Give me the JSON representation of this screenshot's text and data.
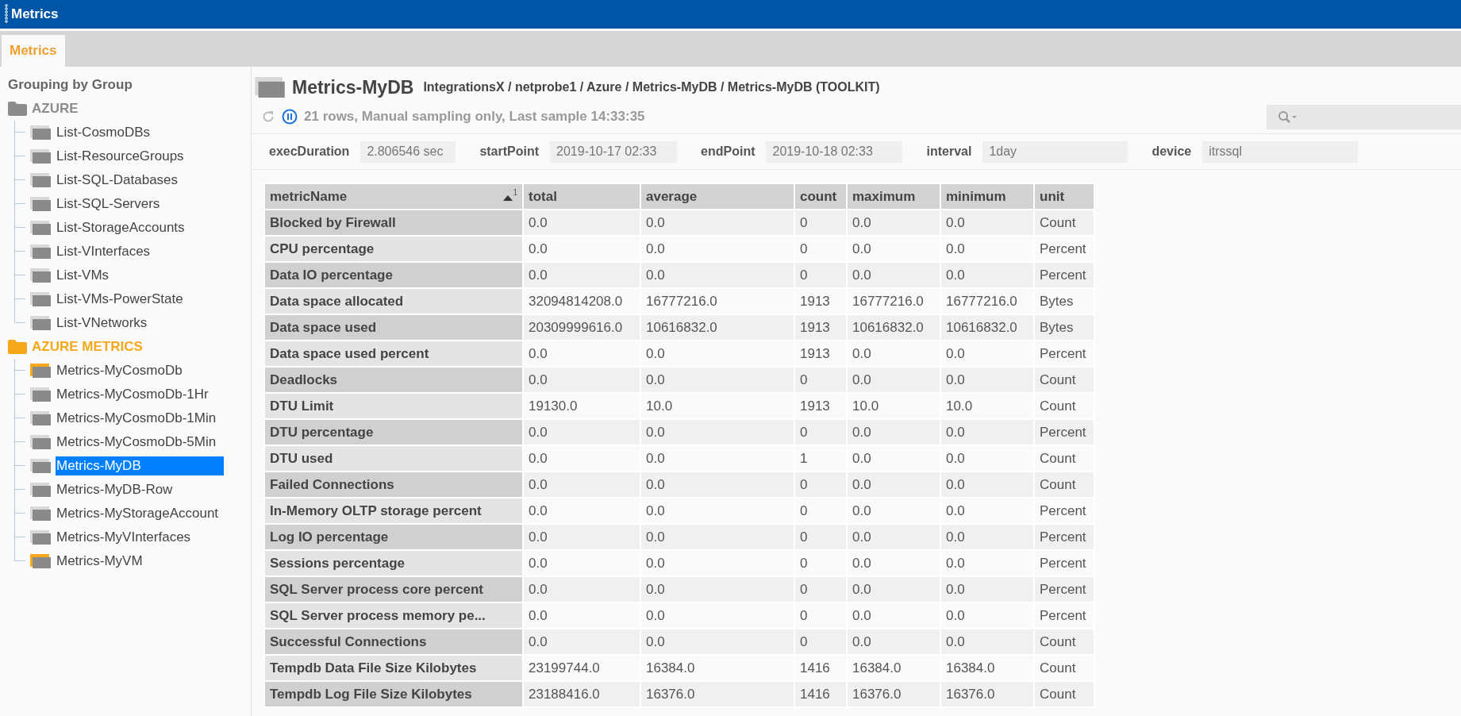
{
  "window": {
    "title": "Metrics"
  },
  "tabs": [
    {
      "label": "Metrics",
      "selected": true
    }
  ],
  "sidebar": {
    "title": "Grouping by Group",
    "groups": [
      {
        "label": "AZURE",
        "color": "#8c8c8c",
        "children": [
          {
            "label": "List-CosmoDBs",
            "selected": false,
            "highlighted": false
          },
          {
            "label": "List-ResourceGroups",
            "selected": false,
            "highlighted": false
          },
          {
            "label": "List-SQL-Databases",
            "selected": false,
            "highlighted": false
          },
          {
            "label": "List-SQL-Servers",
            "selected": false,
            "highlighted": false
          },
          {
            "label": "List-StorageAccounts",
            "selected": false,
            "highlighted": false
          },
          {
            "label": "List-VInterfaces",
            "selected": false,
            "highlighted": false
          },
          {
            "label": "List-VMs",
            "selected": false,
            "highlighted": false
          },
          {
            "label": "List-VMs-PowerState",
            "selected": false,
            "highlighted": false
          },
          {
            "label": "List-VNetworks",
            "selected": false,
            "highlighted": false
          }
        ]
      },
      {
        "label": "AZURE METRICS",
        "color": "#f5a81c",
        "children": [
          {
            "label": "Metrics-MyCosmoDb",
            "selected": false,
            "highlighted": true
          },
          {
            "label": "Metrics-MyCosmoDb-1Hr",
            "selected": false,
            "highlighted": false
          },
          {
            "label": "Metrics-MyCosmoDb-1Min",
            "selected": false,
            "highlighted": false
          },
          {
            "label": "Metrics-MyCosmoDb-5Min",
            "selected": false,
            "highlighted": false
          },
          {
            "label": "Metrics-MyDB",
            "selected": true,
            "highlighted": false
          },
          {
            "label": "Metrics-MyDB-Row",
            "selected": false,
            "highlighted": false
          },
          {
            "label": "Metrics-MyStorageAccount",
            "selected": false,
            "highlighted": false
          },
          {
            "label": "Metrics-MyVInterfaces",
            "selected": false,
            "highlighted": false
          },
          {
            "label": "Metrics-MyVM",
            "selected": false,
            "highlighted": true
          }
        ]
      }
    ]
  },
  "header": {
    "title": "Metrics-MyDB",
    "path": "IntegrationsX / netprobe1 / Azure / Metrics-MyDB / Metrics-MyDB (TOOLKIT)",
    "status": "21 rows, Manual sampling only, Last sample 14:33:35",
    "paused": true
  },
  "params": [
    {
      "label": "execDuration",
      "value": "2.806546 sec"
    },
    {
      "label": "startPoint",
      "value": "2019-10-17 02:33"
    },
    {
      "label": "endPoint",
      "value": "2019-10-18 02:33"
    },
    {
      "label": "interval",
      "value": "1day"
    },
    {
      "label": "device",
      "value": "itrssql"
    }
  ],
  "table": {
    "columns": [
      {
        "label": "metricName",
        "sorted": true,
        "sort_rank": "1"
      },
      {
        "label": "total",
        "sorted": false
      },
      {
        "label": "average",
        "sorted": false
      },
      {
        "label": "count",
        "sorted": false
      },
      {
        "label": "maximum",
        "sorted": false
      },
      {
        "label": "minimum",
        "sorted": false
      },
      {
        "label": "unit",
        "sorted": false
      }
    ],
    "rows": [
      [
        "Blocked by Firewall",
        "0.0",
        "0.0",
        "0",
        "0.0",
        "0.0",
        "Count"
      ],
      [
        "CPU percentage",
        "0.0",
        "0.0",
        "0",
        "0.0",
        "0.0",
        "Percent"
      ],
      [
        "Data IO percentage",
        "0.0",
        "0.0",
        "0",
        "0.0",
        "0.0",
        "Percent"
      ],
      [
        "Data space allocated",
        "32094814208.0",
        "16777216.0",
        "1913",
        "16777216.0",
        "16777216.0",
        "Bytes"
      ],
      [
        "Data space used",
        "20309999616.0",
        "10616832.0",
        "1913",
        "10616832.0",
        "10616832.0",
        "Bytes"
      ],
      [
        "Data space used percent",
        "0.0",
        "0.0",
        "1913",
        "0.0",
        "0.0",
        "Percent"
      ],
      [
        "Deadlocks",
        "0.0",
        "0.0",
        "0",
        "0.0",
        "0.0",
        "Count"
      ],
      [
        "DTU Limit",
        "19130.0",
        "10.0",
        "1913",
        "10.0",
        "10.0",
        "Count"
      ],
      [
        "DTU percentage",
        "0.0",
        "0.0",
        "0",
        "0.0",
        "0.0",
        "Percent"
      ],
      [
        "DTU used",
        "0.0",
        "0.0",
        "1",
        "0.0",
        "0.0",
        "Count"
      ],
      [
        "Failed Connections",
        "0.0",
        "0.0",
        "0",
        "0.0",
        "0.0",
        "Count"
      ],
      [
        "In-Memory OLTP storage percent",
        "0.0",
        "0.0",
        "0",
        "0.0",
        "0.0",
        "Percent"
      ],
      [
        "Log IO percentage",
        "0.0",
        "0.0",
        "0",
        "0.0",
        "0.0",
        "Percent"
      ],
      [
        "Sessions percentage",
        "0.0",
        "0.0",
        "0",
        "0.0",
        "0.0",
        "Percent"
      ],
      [
        "SQL Server process core percent",
        "0.0",
        "0.0",
        "0",
        "0.0",
        "0.0",
        "Percent"
      ],
      [
        "SQL Server process memory pe...",
        "0.0",
        "0.0",
        "0",
        "0.0",
        "0.0",
        "Percent"
      ],
      [
        "Successful Connections",
        "0.0",
        "0.0",
        "0",
        "0.0",
        "0.0",
        "Count"
      ],
      [
        "Tempdb Data File Size Kilobytes",
        "23199744.0",
        "16384.0",
        "1416",
        "16384.0",
        "16384.0",
        "Count"
      ],
      [
        "Tempdb Log File Size Kilobytes",
        "23188416.0",
        "16376.0",
        "1416",
        "16376.0",
        "16376.0",
        "Count"
      ]
    ]
  }
}
